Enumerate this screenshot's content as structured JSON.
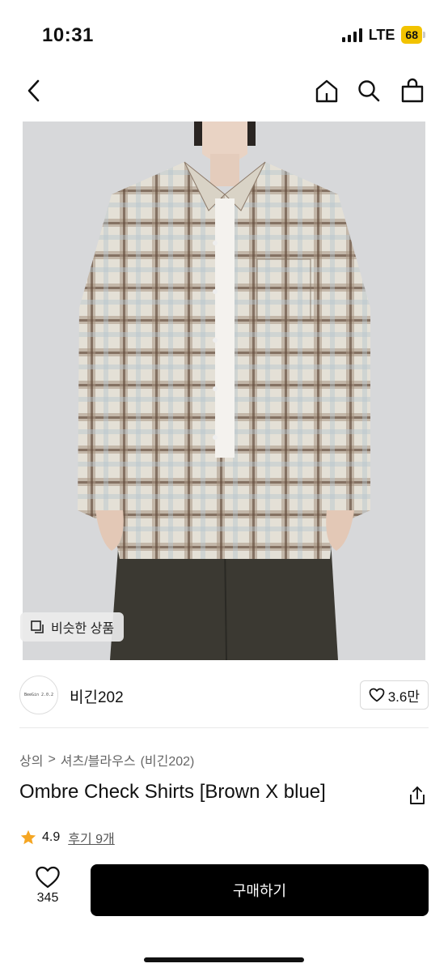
{
  "status_bar": {
    "time": "10:31",
    "network": "LTE",
    "battery": "68"
  },
  "nav": {
    "back_icon": "chevron-left-icon",
    "home_icon": "home-icon",
    "search_icon": "search-icon",
    "cart_icon": "shopping-bag-icon"
  },
  "image": {
    "similar_products_label": "비슷한 상품"
  },
  "brand": {
    "logo_text": "BeeGin 2.0.2",
    "name": "비긴202",
    "likes": "3.6만"
  },
  "breadcrumb": {
    "category": "상의",
    "separator": ">",
    "subcategory": "셔츠/블라우스",
    "brand_tag": "(비긴202)"
  },
  "product": {
    "title": "Ombre Check Shirts [Brown X blue]"
  },
  "rating": {
    "score": "4.9",
    "reviews": "후기 9개"
  },
  "bottom_bar": {
    "wish_count": "345",
    "buy_label": "구매하기"
  },
  "colors": {
    "primary_button": "#000000",
    "star": "#f5a623",
    "battery": "#f2c300"
  }
}
